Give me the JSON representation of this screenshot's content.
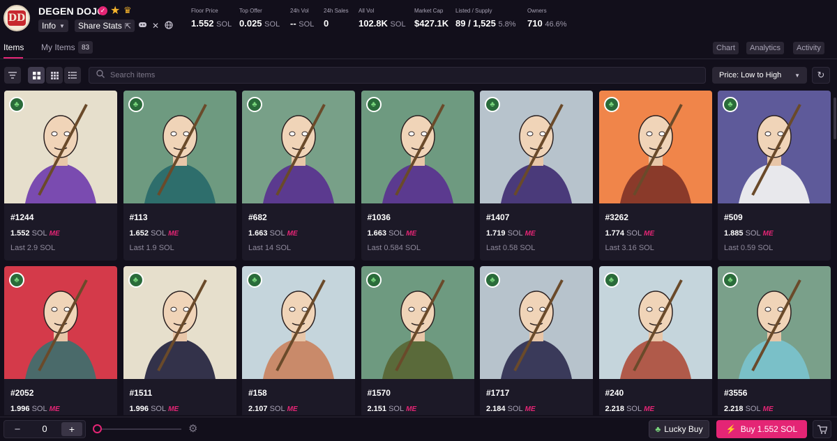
{
  "collection": {
    "name": "DEGEN DOJO",
    "logo_text": "DD",
    "info_label": "Info",
    "share_label": "Share Stats"
  },
  "stats": {
    "floor_price": {
      "label": "Floor Price",
      "value": "1.552",
      "unit": "SOL"
    },
    "top_offer": {
      "label": "Top Offer",
      "value": "0.025",
      "unit": "SOL"
    },
    "vol_24h": {
      "label": "24h Vol",
      "value": "--",
      "unit": "SOL"
    },
    "sales_24h": {
      "label": "24h Sales",
      "value": "0"
    },
    "all_vol": {
      "label": "All Vol",
      "value": "102.8K",
      "unit": "SOL"
    },
    "market_cap": {
      "label": "Market Cap",
      "value": "$427.1K"
    },
    "listed_supply": {
      "label": "Listed / Supply",
      "value": "89 / 1,525",
      "pct": "5.8%"
    },
    "owners": {
      "label": "Owners",
      "value": "710",
      "pct": "46.6%"
    }
  },
  "tabs": {
    "items": "Items",
    "my_items": "My Items",
    "my_items_count": "83",
    "chart": "Chart",
    "analytics": "Analytics",
    "activity": "Activity"
  },
  "toolbar": {
    "search_placeholder": "Search items",
    "sort_label": "Price: Low to High"
  },
  "items": [
    {
      "id": "#1244",
      "price": "1.552",
      "unit": "SOL",
      "last": "Last 2.9 SOL",
      "bg": "#e6dfcc"
    },
    {
      "id": "#113",
      "price": "1.652",
      "unit": "SOL",
      "last": "Last 1.9 SOL",
      "bg": "#6e9a80"
    },
    {
      "id": "#682",
      "price": "1.663",
      "unit": "SOL",
      "last": "Last 14 SOL",
      "bg": "#78a088"
    },
    {
      "id": "#1036",
      "price": "1.663",
      "unit": "SOL",
      "last": "Last 0.584 SOL",
      "bg": "#6e9a80"
    },
    {
      "id": "#1407",
      "price": "1.719",
      "unit": "SOL",
      "last": "Last 0.58 SOL",
      "bg": "#b7c3cc"
    },
    {
      "id": "#3262",
      "price": "1.774",
      "unit": "SOL",
      "last": "Last 3.16 SOL",
      "bg": "#f0854a"
    },
    {
      "id": "#509",
      "price": "1.885",
      "unit": "SOL",
      "last": "Last 0.59 SOL",
      "bg": "#5e5a9a"
    },
    {
      "id": "#2052",
      "price": "1.996",
      "unit": "SOL",
      "last": "",
      "bg": "#d43a4a"
    },
    {
      "id": "#1511",
      "price": "1.996",
      "unit": "SOL",
      "last": "",
      "bg": "#e6dfcc"
    },
    {
      "id": "#158",
      "price": "2.107",
      "unit": "SOL",
      "last": "",
      "bg": "#c5d5dc"
    },
    {
      "id": "#1570",
      "price": "2.151",
      "unit": "SOL",
      "last": "",
      "bg": "#6e9a80"
    },
    {
      "id": "#1717",
      "price": "2.184",
      "unit": "SOL",
      "last": "",
      "bg": "#b7c3cc"
    },
    {
      "id": "#240",
      "price": "2.218",
      "unit": "SOL",
      "last": "",
      "bg": "#c5d5dc"
    },
    {
      "id": "#3556",
      "price": "2.218",
      "unit": "SOL",
      "last": "",
      "bg": "#7aa08a"
    }
  ],
  "footer": {
    "quantity": "0",
    "lucky_label": "Lucky Buy",
    "buy_label": "Buy 1.552 SOL"
  },
  "colors": {
    "accent": "#e42575",
    "background": "#120f1b",
    "card": "#1c1927"
  }
}
